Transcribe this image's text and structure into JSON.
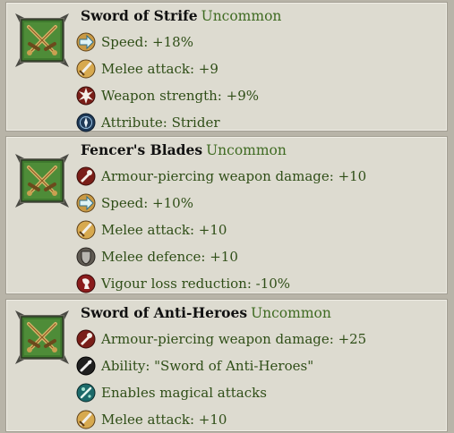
{
  "items": [
    {
      "name": "Sword of Strife",
      "rarity": "Uncommon",
      "icon": "crossed-swords-icon",
      "stats": [
        {
          "icon": "speed-arrow-icon",
          "text": "Speed: +18%"
        },
        {
          "icon": "melee-attack-sword-icon",
          "text": "Melee attack: +9"
        },
        {
          "icon": "weapon-strength-burst-icon",
          "text": "Weapon strength: +9%"
        },
        {
          "icon": "attribute-icon",
          "text": "Attribute: Strider"
        }
      ]
    },
    {
      "name": "Fencer's Blades",
      "rarity": "Uncommon",
      "icon": "crossed-swords-icon",
      "stats": [
        {
          "icon": "armour-piercing-icon",
          "text": "Armour-piercing weapon damage: +10"
        },
        {
          "icon": "speed-arrow-icon",
          "text": "Speed: +10%"
        },
        {
          "icon": "melee-attack-sword-icon",
          "text": "Melee attack: +10"
        },
        {
          "icon": "melee-defence-shield-icon",
          "text": "Melee defence: +10"
        },
        {
          "icon": "vigour-icon",
          "text": "Vigour loss reduction: -10%"
        }
      ]
    },
    {
      "name": "Sword of Anti-Heroes",
      "rarity": "Uncommon",
      "icon": "crossed-swords-icon",
      "stats": [
        {
          "icon": "armour-piercing-icon",
          "text": "Armour-piercing weapon damage: +25"
        },
        {
          "icon": "ability-icon",
          "text": "Ability: \"Sword of Anti-Heroes\""
        },
        {
          "icon": "magical-attacks-icon",
          "text": "Enables magical attacks"
        },
        {
          "icon": "melee-attack-sword-icon",
          "text": "Melee attack: +10"
        }
      ]
    }
  ],
  "colors": {
    "rarity": "#3f6b22",
    "stat_text": "#2f4e17",
    "card_bg": "#dddbd0"
  }
}
